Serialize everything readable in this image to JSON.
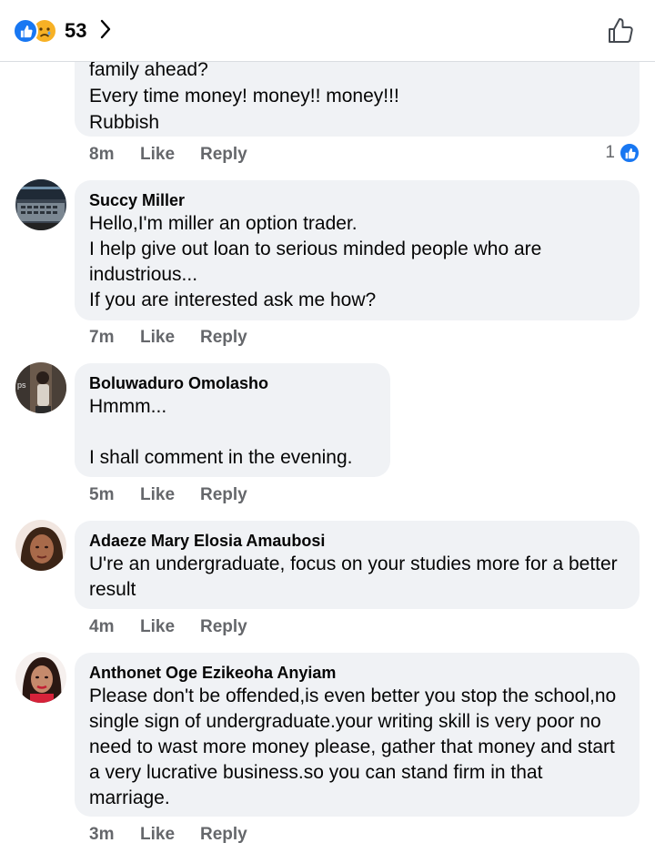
{
  "header": {
    "reaction_count": "53",
    "icons": [
      "like-icon",
      "sad-icon",
      "chevron-right-icon",
      "thumb-up-outline-icon"
    ]
  },
  "comments": [
    {
      "author": "",
      "text": "family ahead?\nEvery time money! money!! money!!!\nRubbish",
      "time": "8m",
      "like": "Like",
      "reply": "Reply",
      "reactions": "1"
    },
    {
      "author": "Succy Miller",
      "text": "Hello,I'm miller an option trader.\nI help give out loan to serious minded people who are industrious...\nIf you are interested ask me how?",
      "time": "7m",
      "like": "Like",
      "reply": "Reply"
    },
    {
      "author": "Boluwaduro Omolasho",
      "text": "Hmmm...\n\nI shall comment in the evening.",
      "time": "5m",
      "like": "Like",
      "reply": "Reply"
    },
    {
      "author": "Adaeze Mary Elosia Amaubosi",
      "text": "U're an undergraduate, focus on your studies more for a better result",
      "time": "4m",
      "like": "Like",
      "reply": "Reply"
    },
    {
      "author": "Anthonet Oge Ezikeoha Anyiam",
      "text": "Please don't be offended,is even better you stop the school,no single sign of undergraduate.your writing skill is very poor no need to wast more money please, gather that money and start a very lucrative business.so you can stand firm in that marriage.",
      "time": "3m",
      "like": "Like",
      "reply": "Reply"
    }
  ],
  "colors": {
    "accent": "#1877f2",
    "bubble": "#f0f2f5",
    "meta_text": "#65676b",
    "sad_emoji": "#f7b125"
  }
}
